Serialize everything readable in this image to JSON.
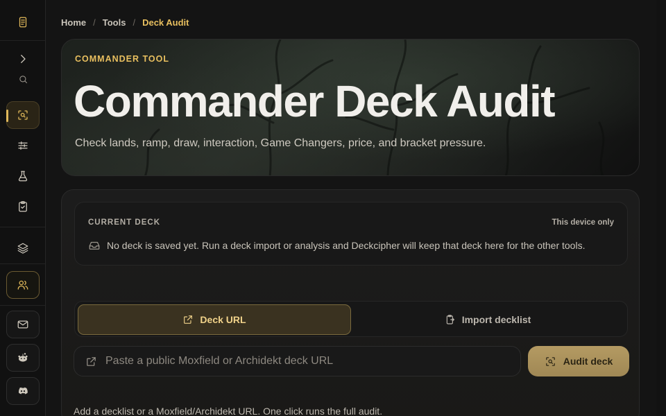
{
  "breadcrumb": {
    "items": [
      "Home",
      "Tools",
      "Deck Audit"
    ],
    "separator": "/"
  },
  "hero": {
    "kicker": "COMMANDER TOOL",
    "title": "Commander Deck Audit",
    "subtitle": "Check lands, ramp, draw, interaction, Game Changers, price, and bracket pressure."
  },
  "current_deck": {
    "label": "CURRENT DECK",
    "storage_note": "This device only",
    "empty_message": "No deck is saved yet. Run a deck import or analysis and Deckcipher will keep that deck here for the other tools."
  },
  "tabs": {
    "deck_url": "Deck URL",
    "import_decklist": "Import decklist",
    "active": "Deck URL"
  },
  "url_input": {
    "value": "",
    "placeholder": "Paste a public Moxfield or Archidekt deck URL"
  },
  "audit_button": {
    "label": "Audit deck"
  },
  "hint": "Add a decklist or a Moxfield/Archidekt URL. One click runs the full audit.",
  "sidebar": {
    "icons": [
      "logo-icon",
      "expand-chevron-icon",
      "search-icon",
      "deck-audit-icon",
      "sliders-icon",
      "flask-icon",
      "clipboard-check-icon",
      "layers-icon",
      "users-icon",
      "mail-icon",
      "reddit-icon",
      "discord-icon"
    ],
    "active": "deck-audit-icon"
  },
  "colors": {
    "accent": "#e0b85a",
    "background": "#141414",
    "button": "#b49a62"
  }
}
